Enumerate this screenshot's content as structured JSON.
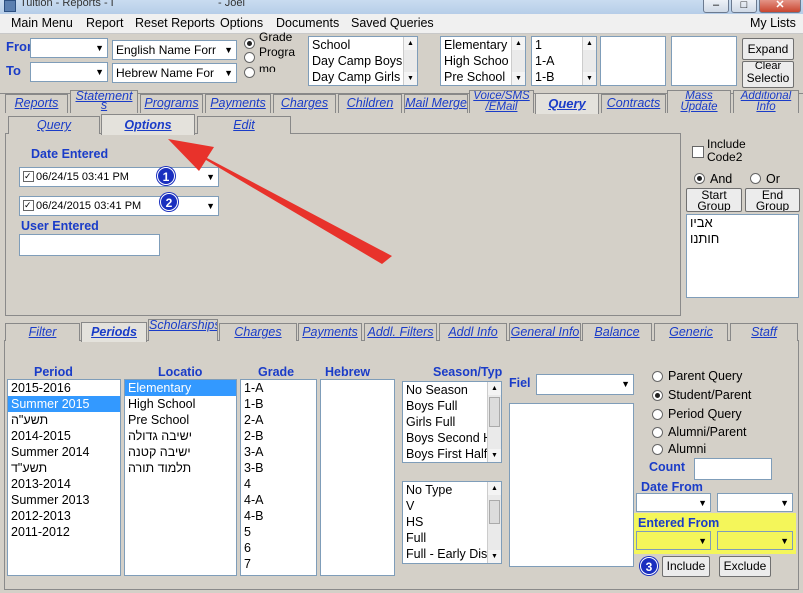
{
  "window": {
    "title": "Tuition - Reports - I",
    "title_user": "Joel"
  },
  "menu": {
    "items": [
      "Main Menu",
      "Report",
      "Reset Reports",
      "Options",
      "Documents",
      "Saved Queries"
    ],
    "right": "My Lists"
  },
  "top": {
    "from_label": "From",
    "to_label": "To",
    "name_format_1": "English Name Forr",
    "name_format_2": "Hebrew Name For",
    "radio_grade": "Grade",
    "radio_program": "Progra",
    "radio_third": "mo",
    "program_list": [
      "School",
      "Day Camp Boys",
      "Day Camp Girls"
    ],
    "level_list": [
      "Elementary",
      "High Schoo",
      "Pre School"
    ],
    "class_list": [
      "1",
      "1-A",
      "1-B"
    ],
    "expand_button": "Expand",
    "clear_button_top": "Clear",
    "clear_button_bottom": "Selectio"
  },
  "main_tabs": [
    "Reports",
    "Statement s",
    "Programs",
    "Payments",
    "Charges",
    "Children",
    "Mail Merge",
    "Voice/SMS /EMail",
    "Query",
    "Contracts",
    "Mass Update",
    "Additional Info"
  ],
  "sub_tabs": [
    "Query",
    "Options",
    "Edit"
  ],
  "options": {
    "date_entered_label": "Date Entered",
    "date1": "06/24/15 03:41 PM",
    "date2": "06/24/2015 03:41 PM",
    "user_entered_label": "User Entered",
    "user_entered_value": ""
  },
  "right_panel": {
    "include_code2": "Include Code2",
    "and_label": "And",
    "or_label": "Or",
    "start_group": "Start Group",
    "end_group": "End Group",
    "hebrew_list": [
      "אביו",
      "חותנו"
    ]
  },
  "filter_tabs": [
    "Filter",
    "Periods",
    "Scholarships",
    "Charges",
    "Payments",
    "Addl. Filters",
    "Addl Info",
    "General Info",
    "Balance",
    "Generic",
    "Staff"
  ],
  "periods": {
    "period_header": "Period",
    "periods": [
      "2015-2016",
      "Summer 2015",
      "תשע\"ה",
      "2014-2015",
      "Summer 2014",
      "תשע\"ד",
      "2013-2014",
      "Summer 2013",
      "2012-2013",
      "2011-2012"
    ],
    "period_selected": 1,
    "location_header": "Locatio",
    "locations": [
      "Elementary",
      "High School",
      "Pre School",
      "ישיבה גדולה",
      "ישיבה קטנה",
      "תלמוד תורה"
    ],
    "location_selected": 0,
    "grade_header": "Grade",
    "grades": [
      "1-A",
      "1-B",
      "2-A",
      "2-B",
      "3-A",
      "3-B",
      "4",
      "4-A",
      "4-B",
      "5",
      "6",
      "7"
    ],
    "hebrew_header": "Hebrew",
    "season_header": "Season/Typ",
    "seasons": [
      "No Season",
      "Boys Full",
      "Girls Full",
      "Boys Second H",
      "Boys First Half"
    ],
    "types": [
      "No Type",
      "V",
      "HS",
      "Full",
      "Full - Early Dis"
    ],
    "field_label": "Fiel"
  },
  "query_type": {
    "options": [
      "Parent Query",
      "Student/Parent",
      "Period Query",
      "Alumni/Parent",
      "Alumni"
    ],
    "selected": 1,
    "count_label": "Count",
    "date_from_label": "Date From",
    "entered_from_label": "Entered From",
    "include_button": "Include",
    "exclude_button": "Exclude"
  },
  "annotations": {
    "badge1": "1",
    "badge2": "2",
    "badge3": "3",
    "arrow_color": "#e8322b",
    "highlight_color": "#f4f65a"
  }
}
